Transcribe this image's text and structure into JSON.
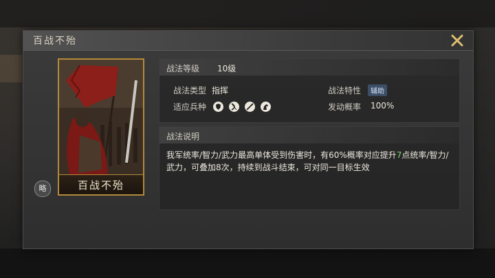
{
  "dialog": {
    "title": "百战不殆"
  },
  "card": {
    "name": "百战不殆",
    "badge": "略"
  },
  "info": {
    "level_label": "战法等级",
    "level_value": "10级",
    "type_label": "战法类型",
    "type_value": "指挥",
    "trait_label": "战法特性",
    "trait_value": "辅助",
    "troops_label": "适应兵种",
    "troops": [
      "shield-icon",
      "bow-icon",
      "spear-icon",
      "horse-icon"
    ],
    "rate_label": "发动概率",
    "rate_value": "100%"
  },
  "description": {
    "header": "战法说明",
    "text_before": "我军统率/智力/武力最高单体受到伤害时，有60%概率对应提升",
    "highlight": "7",
    "text_after": "点统率/智力/武力，可叠加8次，持续到战斗结束，可对同一目标生效"
  },
  "colors": {
    "highlight": "#7cd66f",
    "card_border": "#b48a3c",
    "trait_badge": "#3d4f66"
  }
}
